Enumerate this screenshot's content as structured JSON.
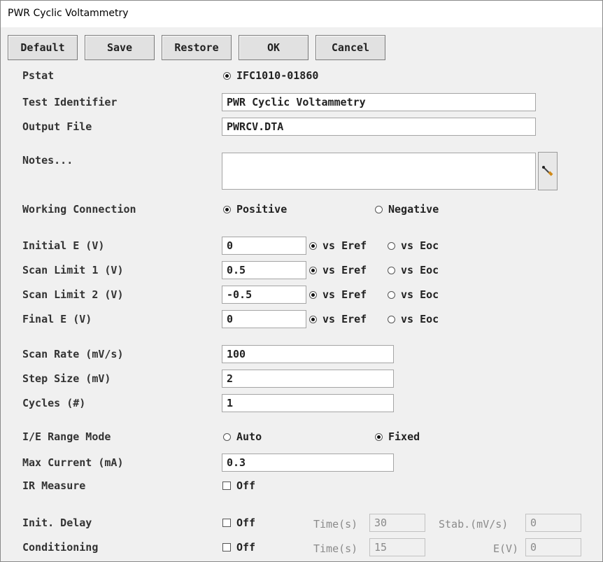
{
  "window": {
    "title": "PWR Cyclic Voltammetry"
  },
  "toolbar": {
    "default_label": "Default",
    "save_label": "Save",
    "restore_label": "Restore",
    "ok_label": "OK",
    "cancel_label": "Cancel"
  },
  "pstat": {
    "label": "Pstat",
    "value": "IFC1010-01860",
    "selected": true
  },
  "test_identifier": {
    "label": "Test Identifier",
    "value": "PWR Cyclic Voltammetry"
  },
  "output_file": {
    "label": "Output File",
    "value": "PWRCV.DTA"
  },
  "notes": {
    "label": "Notes...",
    "value": "",
    "edit_icon": "pencil-icon"
  },
  "working_connection": {
    "label": "Working Connection",
    "options": [
      "Positive",
      "Negative"
    ],
    "selected": "Positive"
  },
  "potentials": [
    {
      "label": "Initial E (V)",
      "value": "0",
      "ref": "vs Eref"
    },
    {
      "label": "Scan Limit 1 (V)",
      "value": "0.5",
      "ref": "vs Eref"
    },
    {
      "label": "Scan Limit 2 (V)",
      "value": "-0.5",
      "ref": "vs Eref"
    },
    {
      "label": "Final E (V)",
      "value": "0",
      "ref": "vs Eref"
    }
  ],
  "ref_options": {
    "eref": "vs Eref",
    "eoc": "vs Eoc"
  },
  "scan_rate": {
    "label": "Scan Rate (mV/s)",
    "value": "100"
  },
  "step_size": {
    "label": "Step Size (mV)",
    "value": "2"
  },
  "cycles": {
    "label": "Cycles (#)",
    "value": "1"
  },
  "ie_range_mode": {
    "label": "I/E Range Mode",
    "options": [
      "Auto",
      "Fixed"
    ],
    "selected": "Fixed"
  },
  "max_current": {
    "label": "Max Current (mA)",
    "value": "0.3"
  },
  "ir_measure": {
    "label": "IR Measure",
    "checkbox_label": "Off",
    "checked": false
  },
  "init_delay": {
    "label": "Init. Delay",
    "checkbox_label": "Off",
    "checked": false,
    "time_label": "Time(s)",
    "time_value": "30",
    "stab_label": "Stab.(mV/s)",
    "stab_value": "0"
  },
  "conditioning": {
    "label": "Conditioning",
    "checkbox_label": "Off",
    "checked": false,
    "time_label": "Time(s)",
    "time_value": "15",
    "e_label": "E(V)",
    "e_value": "0"
  }
}
